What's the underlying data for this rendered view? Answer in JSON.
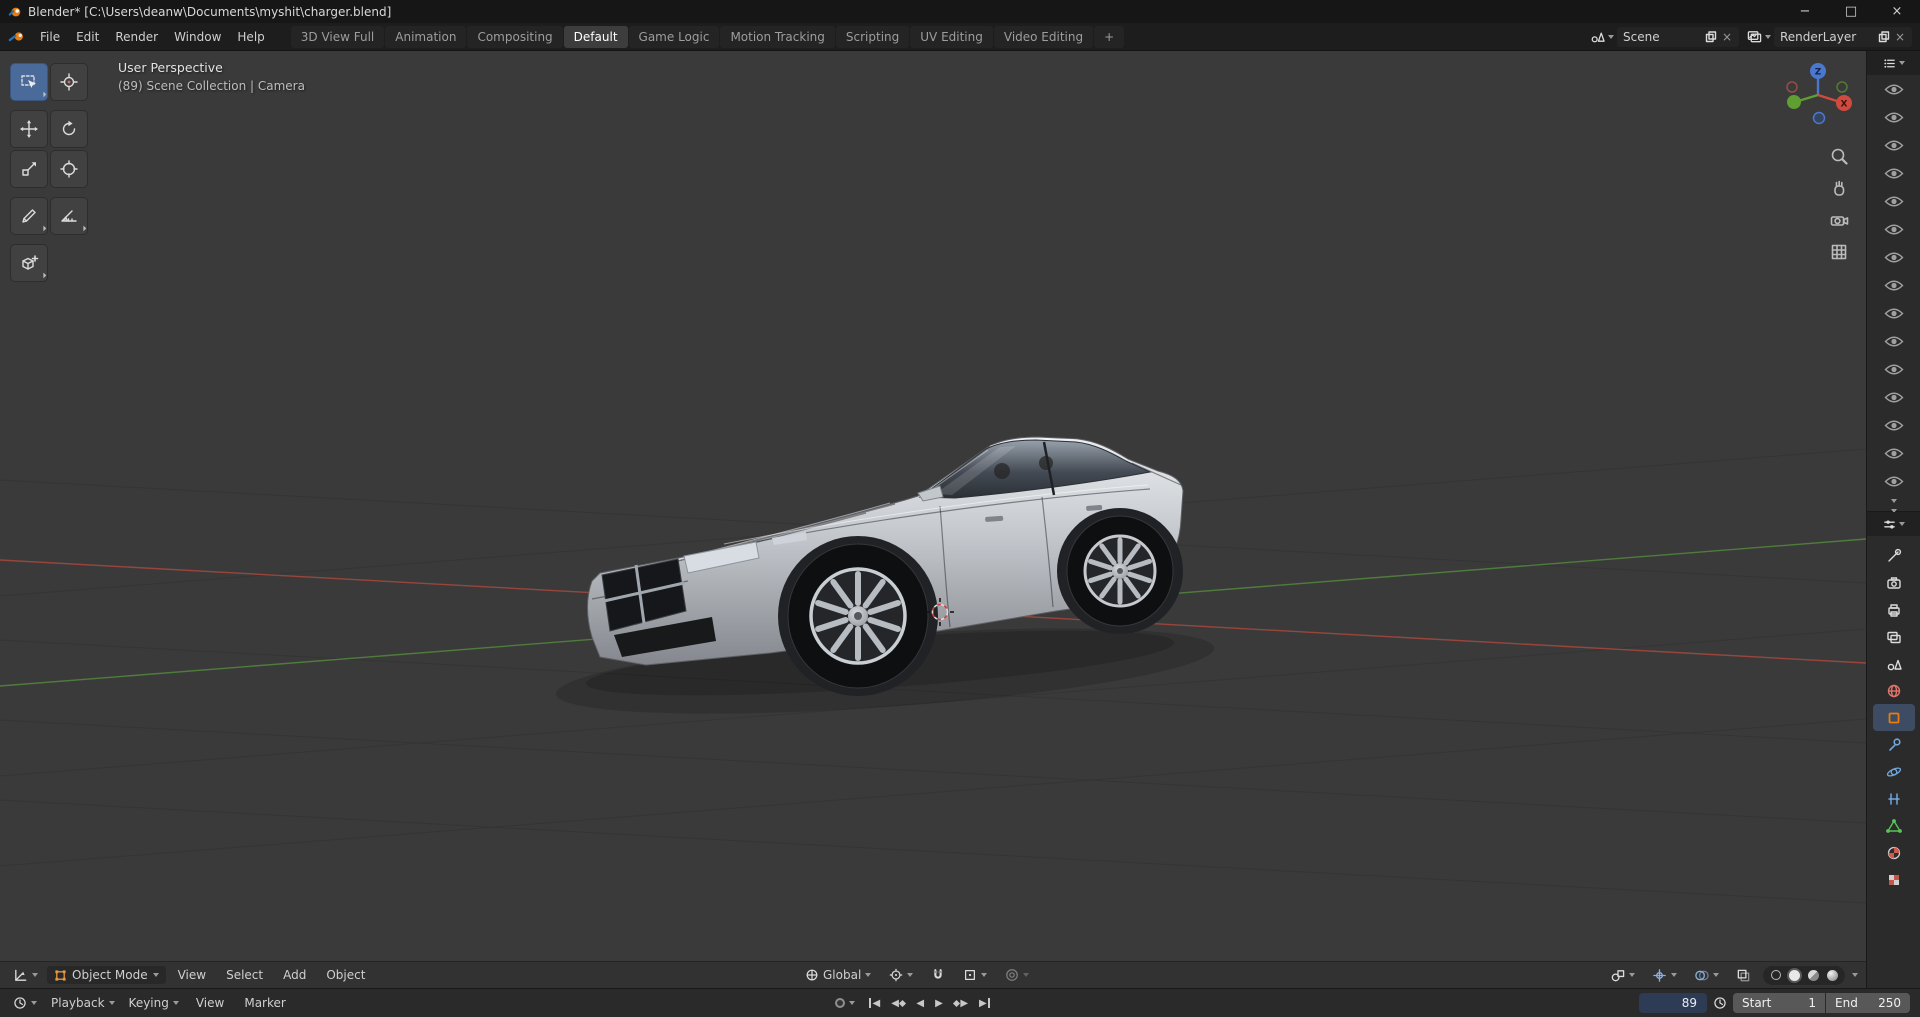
{
  "titlebar": {
    "title": "Blender* [C:\\Users\\deanw\\Documents\\myshit\\charger.blend]",
    "minimize": "−",
    "maximize": "□",
    "close": "×"
  },
  "menubar": {
    "menus": [
      "File",
      "Edit",
      "Render",
      "Window",
      "Help"
    ],
    "tabs": [
      "3D View Full",
      "Animation",
      "Compositing",
      "Default",
      "Game Logic",
      "Motion Tracking",
      "Scripting",
      "UV Editing",
      "Video Editing"
    ],
    "active_tab": "Default",
    "new_tab": "+",
    "scene_value": "Scene",
    "render_layer_value": "RenderLayer"
  },
  "viewport": {
    "overlay_line1": "User Perspective",
    "overlay_line2": "(89) Scene Collection | Camera",
    "header": {
      "mode": "Object Mode",
      "menu_view": "View",
      "menu_select": "Select",
      "menu_add": "Add",
      "menu_object": "Object",
      "orientation": "Global"
    }
  },
  "timeline": {
    "menu_playback": "Playback",
    "menu_keying": "Keying",
    "menu_view": "View",
    "menu_marker": "Marker",
    "current_frame": "89",
    "start_label": "Start",
    "start_value": "1",
    "end_label": "End",
    "end_value": "250"
  },
  "glyphs": {
    "chevron_char": "▾",
    "left": "◀",
    "right": "▶",
    "close": "×"
  },
  "colors": {
    "active_tool_blue": "#4a6b9a",
    "object_orange": "#e87d0d",
    "axis_x_red": "#b0493e",
    "axis_y_green": "#57923d",
    "axis_z_blue": "#4a78d0"
  }
}
